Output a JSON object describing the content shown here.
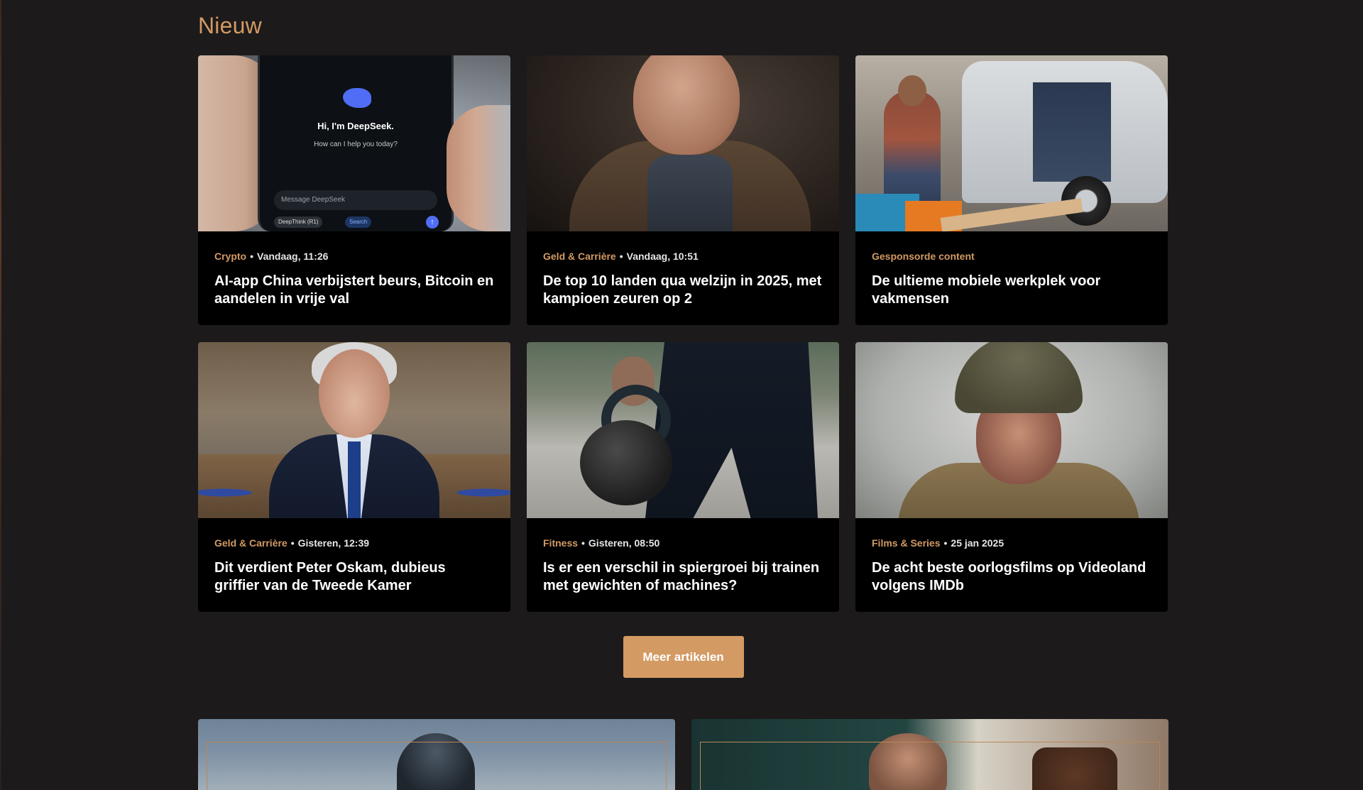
{
  "section": {
    "title": "Nieuw"
  },
  "articles": [
    {
      "category": "Crypto",
      "date": "Vandaag, 11:26",
      "title": "AI-app China verbijstert beurs, Bitcoin en aandelen in vrije val",
      "image": {
        "phone_title": "Hi, I'm DeepSeek.",
        "phone_subtitle": "How can I help you today?",
        "phone_input_placeholder": "Message DeepSeek",
        "phone_button_1": "DeepThink (R1)",
        "phone_button_2": "Search"
      }
    },
    {
      "category": "Geld & Carrière",
      "date": "Vandaag, 10:51",
      "title": "De top 10 landen qua welzijn in 2025, met kampioen zeuren op 2"
    },
    {
      "category": "Gesponsorde content",
      "date": "",
      "title": "De ultieme mobiele werkplek voor vakmensen"
    },
    {
      "category": "Geld & Carrière",
      "date": "Gisteren, 12:39",
      "title": "Dit verdient Peter Oskam, dubieus griffier van de Tweede Kamer"
    },
    {
      "category": "Fitness",
      "date": "Gisteren, 08:50",
      "title": "Is er een verschil in spiergroei bij trainen met gewichten of machines?"
    },
    {
      "category": "Films & Series",
      "date": "25 jan 2025",
      "title": "De acht beste oorlogsfilms op Videoland volgens IMDb"
    }
  ],
  "more_button": {
    "label": "Meer artikelen"
  },
  "colors": {
    "accent": "#d39a63",
    "background": "#1c1a1b",
    "card_background": "#000000",
    "text": "#ffffff"
  }
}
